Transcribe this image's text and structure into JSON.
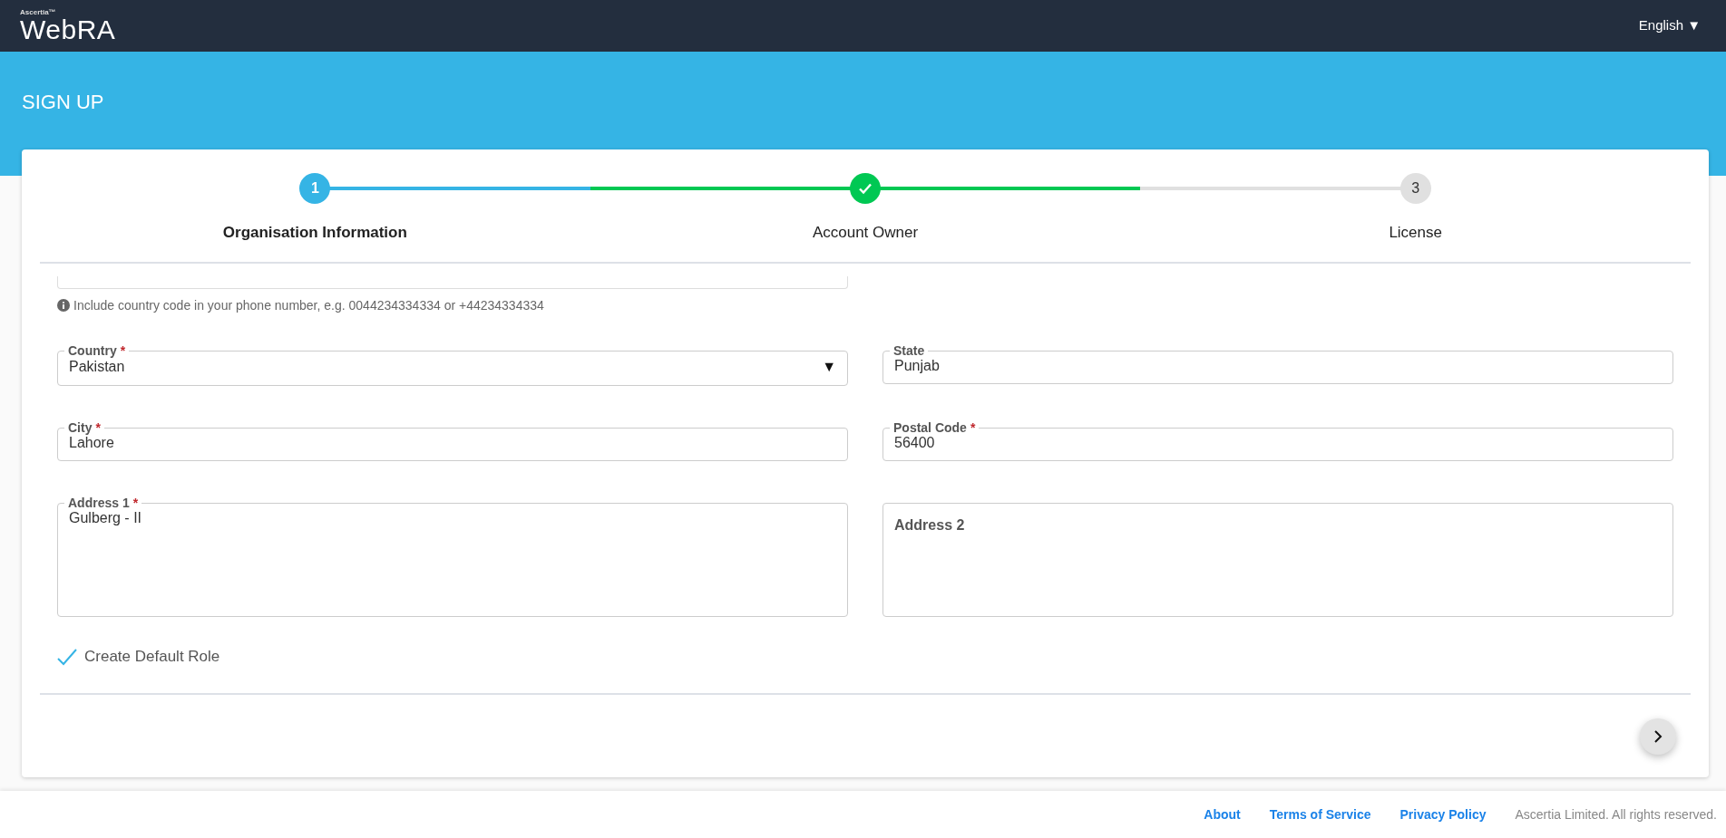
{
  "header": {
    "logo_small": "Ascertia™",
    "logo": "WebRA",
    "language": "English",
    "language_caret": "▼"
  },
  "page_title": "SIGN UP",
  "steps": [
    {
      "label": "Organisation Information",
      "number": "1",
      "selected": true,
      "completed": false
    },
    {
      "label": "Account Owner",
      "selected": false,
      "completed": true
    },
    {
      "label": "License",
      "number": "3",
      "selected": false,
      "completed": false
    }
  ],
  "helper_text": "Include country code in your phone number, e.g. 0044234334334 or +44234334334",
  "fields": [
    {
      "kind": "select",
      "label": "Country",
      "required_mark": "*",
      "value": "Pakistan",
      "caret": "▼"
    },
    {
      "kind": "text",
      "label": "State",
      "value": "Punjab"
    },
    {
      "kind": "text",
      "label": "City",
      "required_mark": "*",
      "value": "Lahore"
    },
    {
      "kind": "text",
      "label": "Postal Code",
      "required_mark": "*",
      "value": "56400"
    },
    {
      "kind": "textarea",
      "label": "Address 1",
      "required_mark": "*",
      "value": "Gulberg - II"
    },
    {
      "kind": "textarea",
      "placeholder": "Address 2"
    }
  ],
  "checkbox": {
    "label": "Create Default Role",
    "checked": true
  },
  "footer": {
    "links": [
      "About",
      "Terms of Service",
      "Privacy Policy"
    ],
    "copyright": "Ascertia Limited. All rights reserved."
  }
}
